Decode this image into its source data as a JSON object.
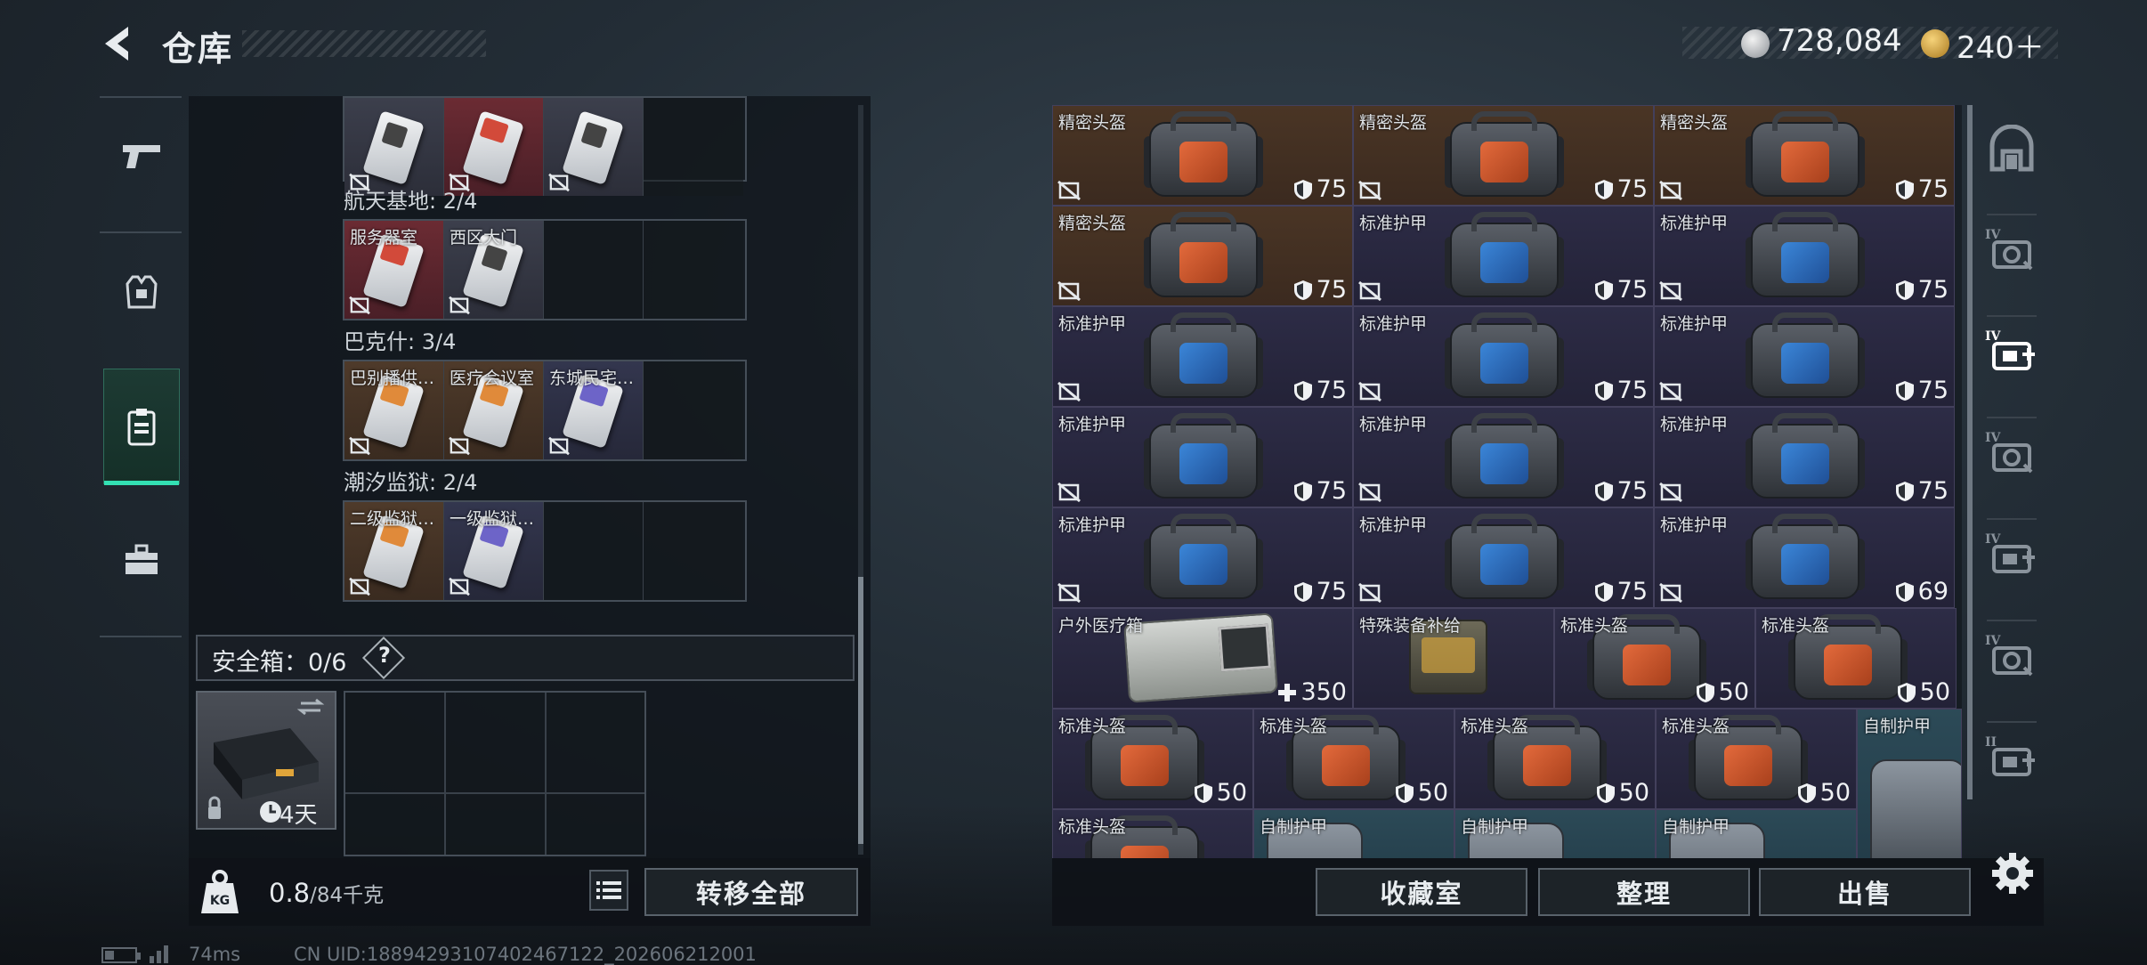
{
  "header": {
    "title": "仓库",
    "currency_silver": "728,084",
    "currency_gold": "240＋"
  },
  "left_nav": {
    "items": [
      {
        "name": "weapons",
        "icon": "pistol-icon"
      },
      {
        "name": "equipment",
        "icon": "armor-vest-icon"
      },
      {
        "name": "keycards",
        "icon": "keycard-holder-icon",
        "active": true
      },
      {
        "name": "toolbox",
        "icon": "toolbox-icon"
      }
    ]
  },
  "keycards": {
    "top_row": {
      "slots": [
        {
          "name": "",
          "color": "gray"
        },
        {
          "name": "",
          "color": "red"
        },
        {
          "name": "",
          "color": "gray"
        },
        {
          "name": "",
          "color": "empty"
        }
      ]
    },
    "groups": [
      {
        "label": "航天基地: 2/4",
        "slots": [
          {
            "name": "服务器室",
            "color": "red"
          },
          {
            "name": "西区大门",
            "color": "gray"
          }
        ]
      },
      {
        "label": "巴克什: 3/4",
        "slots": [
          {
            "name": "巴别播供…",
            "color": "brown"
          },
          {
            "name": "医疗会议室",
            "color": "brown"
          },
          {
            "name": "东城民宅…",
            "color": "navy"
          }
        ]
      },
      {
        "label": "潮汐监狱: 2/4",
        "slots": [
          {
            "name": "二级监狱…",
            "color": "brown"
          },
          {
            "name": "一级监狱…",
            "color": "navy"
          }
        ]
      }
    ]
  },
  "safe_box": {
    "label": "安全箱：0/6",
    "help": "?",
    "duration": "4天"
  },
  "bottom_left": {
    "weight_value": "0.8",
    "weight_max": "/84千克",
    "weight_icon_label": "KG",
    "transfer_all": "转移全部"
  },
  "grid": {
    "rows": [
      [
        {
          "name": "精密头盔",
          "value": "75",
          "kind": "helmet",
          "bg": "brown"
        },
        {
          "name": "精密头盔",
          "value": "75",
          "kind": "helmet",
          "bg": "brown"
        },
        {
          "name": "精密头盔",
          "value": "75",
          "kind": "helmet",
          "bg": "brown"
        }
      ],
      [
        {
          "name": "精密头盔",
          "value": "75",
          "kind": "helmet",
          "bg": "brown"
        },
        {
          "name": "标准护甲",
          "value": "75",
          "kind": "armor",
          "bg": "navy"
        },
        {
          "name": "标准护甲",
          "value": "75",
          "kind": "armor",
          "bg": "navy"
        }
      ],
      [
        {
          "name": "标准护甲",
          "value": "75",
          "kind": "armor",
          "bg": "navy"
        },
        {
          "name": "标准护甲",
          "value": "75",
          "kind": "armor",
          "bg": "navy"
        },
        {
          "name": "标准护甲",
          "value": "75",
          "kind": "armor",
          "bg": "navy"
        }
      ],
      [
        {
          "name": "标准护甲",
          "value": "75",
          "kind": "armor",
          "bg": "navy"
        },
        {
          "name": "标准护甲",
          "value": "75",
          "kind": "armor",
          "bg": "navy"
        },
        {
          "name": "标准护甲",
          "value": "75",
          "kind": "armor",
          "bg": "navy"
        }
      ],
      [
        {
          "name": "标准护甲",
          "value": "75",
          "kind": "armor",
          "bg": "navy"
        },
        {
          "name": "标准护甲",
          "value": "75",
          "kind": "armor",
          "bg": "navy"
        },
        {
          "name": "标准护甲",
          "value": "69",
          "kind": "armor",
          "bg": "navy"
        }
      ]
    ],
    "row6": [
      {
        "name": "户外医疗箱",
        "value": "350",
        "kind": "medkit",
        "bg": "navy"
      },
      {
        "name": "特殊装备补给",
        "value": "",
        "kind": "supply",
        "bg": "navy"
      },
      {
        "name": "标准头盔",
        "value": "50",
        "kind": "helmet",
        "bg": "navy"
      },
      {
        "name": "标准头盔",
        "value": "50",
        "kind": "helmet",
        "bg": "navy"
      }
    ],
    "row7": [
      {
        "name": "标准头盔",
        "value": "50",
        "kind": "helmet",
        "bg": "navy"
      },
      {
        "name": "标准头盔",
        "value": "50",
        "kind": "helmet",
        "bg": "navy"
      },
      {
        "name": "标准头盔",
        "value": "50",
        "kind": "helmet",
        "bg": "navy"
      },
      {
        "name": "标准头盔",
        "value": "50",
        "kind": "helmet",
        "bg": "navy"
      }
    ],
    "row7_tall": {
      "name": "自制护甲",
      "kind": "vest",
      "bg": "teal"
    },
    "row8": [
      {
        "name": "标准头盔",
        "kind": "helmet",
        "bg": "navy"
      },
      {
        "name": "自制护甲",
        "kind": "vest",
        "bg": "teal"
      },
      {
        "name": "自制护甲",
        "kind": "vest",
        "bg": "teal"
      },
      {
        "name": "自制护甲",
        "kind": "vest",
        "bg": "teal"
      }
    ]
  },
  "right_side": {
    "icons": [
      {
        "name": "storage-room-icon",
        "label": ""
      },
      {
        "name": "tier4-weapon-icon",
        "label": "IV"
      },
      {
        "name": "tier4-medical-icon",
        "label": "IV",
        "active": true
      },
      {
        "name": "tier4-container-icon",
        "label": "IV"
      },
      {
        "name": "tier4-medkit-icon",
        "label": "IV"
      },
      {
        "name": "tier4-weapon2-icon",
        "label": "IV"
      },
      {
        "name": "tier3-medkit-icon",
        "label": "II"
      }
    ]
  },
  "bottom_right": {
    "collection": "收藏室",
    "sort": "整理",
    "sell": "出售"
  },
  "status": {
    "ping": "74ms",
    "uid": "CN UID:18894293107402467122_202606212001"
  },
  "colors": {
    "accent": "#33e0b3",
    "panel": "#0e1217",
    "helmet_patch": "#e36a3c",
    "armor_patch": "#3b86d8"
  }
}
